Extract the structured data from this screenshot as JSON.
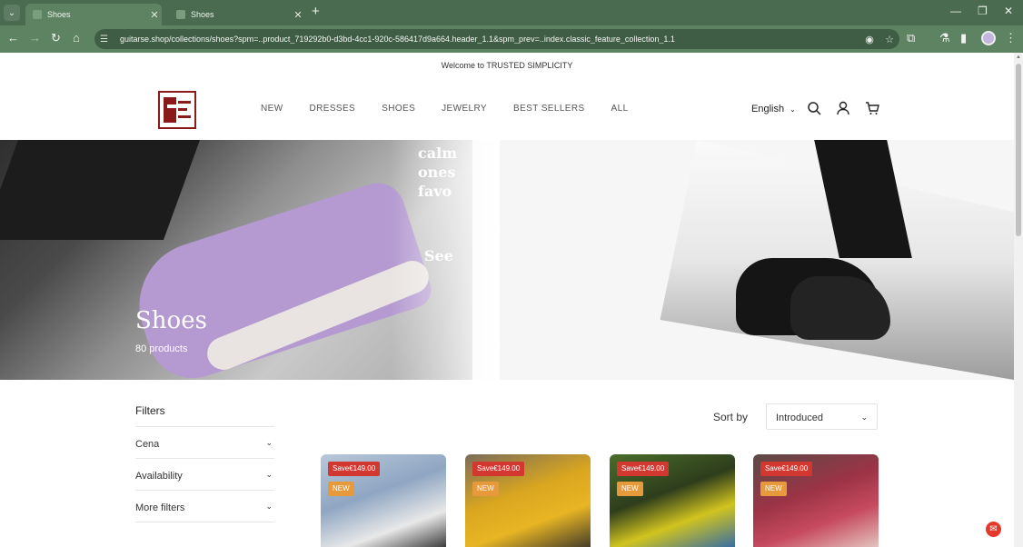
{
  "browser": {
    "tabs": [
      {
        "title": "Shoes",
        "active": true
      },
      {
        "title": "Shoes",
        "active": false
      }
    ],
    "url": "guitarse.shop/collections/shoes?spm=..product_719292b0-d3bd-4cc1-920c-586417d9a664.header_1.1&spm_prev=..index.classic_feature_collection_1.1"
  },
  "store": {
    "announcement": "Welcome to TRUSTED SIMPLICITY",
    "nav": [
      "NEW",
      "DRESSES",
      "SHOES",
      "JEWELRY",
      "BEST SELLERS",
      "ALL"
    ],
    "language": "English"
  },
  "hero": {
    "title": "Shoes",
    "count": "80 products",
    "overlay_text": [
      "calm",
      "ones",
      "favo",
      "See"
    ]
  },
  "filters": {
    "title": "Filters",
    "items": [
      "Cena",
      "Availability",
      "More filters"
    ]
  },
  "sort": {
    "label": "Sort by",
    "value": "Introduced"
  },
  "products": [
    {
      "save": "Save€149.00",
      "badge": "NEW"
    },
    {
      "save": "Save€149.00",
      "badge": "NEW"
    },
    {
      "save": "Save€149.00",
      "badge": "NEW"
    },
    {
      "save": "Save€149.00",
      "badge": "NEW"
    }
  ],
  "colors": {
    "chrome": "#4a6b50",
    "sale": "#d2382f",
    "new": "#e79a3c",
    "logo": "#8a1a1a"
  }
}
